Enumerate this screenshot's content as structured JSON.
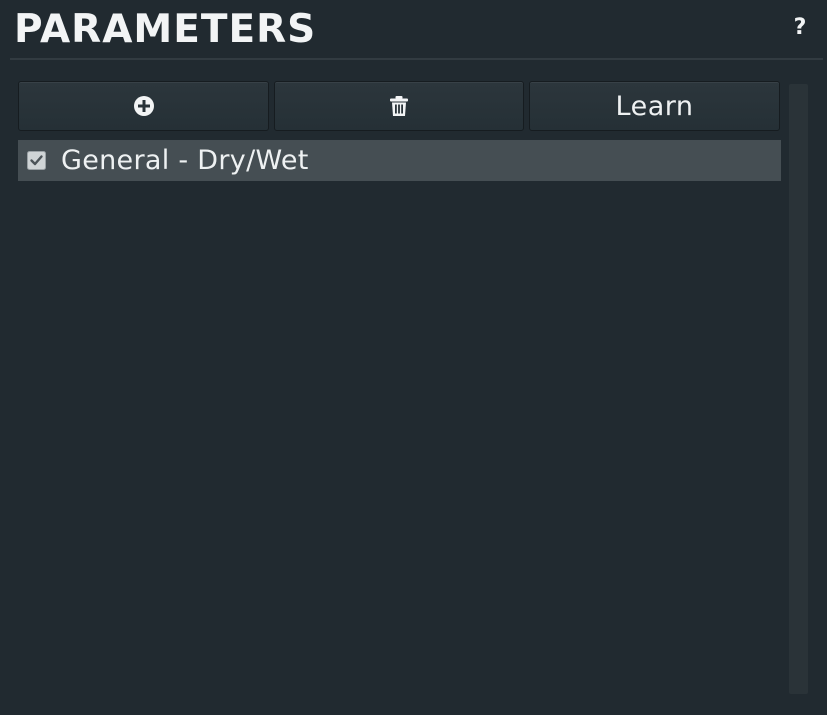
{
  "panel": {
    "title": "PARAMETERS",
    "help_label": "?"
  },
  "toolbar": {
    "add_icon": "plus-circle-icon",
    "delete_icon": "trash-icon",
    "learn_label": "Learn"
  },
  "list": {
    "items": [
      {
        "label": "General - Dry/Wet",
        "checked": true
      }
    ]
  },
  "colors": {
    "background": "#212a30",
    "button": "#2a343a",
    "selected_row": "#454e53",
    "text": "#eef1f2"
  }
}
